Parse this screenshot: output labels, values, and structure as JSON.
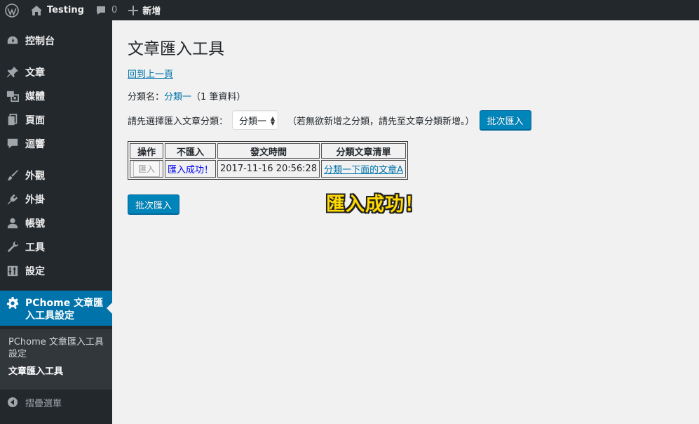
{
  "adminbar": {
    "site_name": "Testing",
    "comments_count": "0",
    "new_label": "新增"
  },
  "sidebar": {
    "items": [
      {
        "label": "控制台",
        "icon": "dashboard-icon"
      },
      {
        "label": "文章",
        "icon": "pin-icon"
      },
      {
        "label": "媒體",
        "icon": "media-icon"
      },
      {
        "label": "頁面",
        "icon": "page-icon"
      },
      {
        "label": "迴響",
        "icon": "comment-icon"
      },
      {
        "label": "外觀",
        "icon": "brush-icon"
      },
      {
        "label": "外掛",
        "icon": "plugin-icon"
      },
      {
        "label": "帳號",
        "icon": "user-icon"
      },
      {
        "label": "工具",
        "icon": "wrench-icon"
      },
      {
        "label": "設定",
        "icon": "settings-icon"
      }
    ],
    "current": {
      "label": "PChome 文章匯入工具設定",
      "icon": "gear-icon"
    },
    "submenu": [
      {
        "label": "PChome 文章匯入工具設定",
        "active": false
      },
      {
        "label": "文章匯入工具",
        "active": true
      }
    ],
    "collapse_label": "摺疊選單"
  },
  "main": {
    "title": "文章匯入工具",
    "back_link": "回到上一頁",
    "category_prefix": "分類名：",
    "category_name": "分類一",
    "category_count": "（1 筆資料）",
    "select_label": "請先選擇匯入文章分類：",
    "select_value": "分類一",
    "select_hint": "（若無欲新增之分類，請先至文章分類新增。）",
    "batch_import_label": "批次匯入",
    "table": {
      "headers": [
        "操作",
        "不匯入",
        "發文時間",
        "分類文章清單"
      ],
      "rows": [
        {
          "action": "匯入",
          "skip": "匯入成功！",
          "time": "2017-11-16 20:56:28",
          "post": "分類一下面的文章A"
        }
      ]
    },
    "success_note": "匯入成功！"
  }
}
